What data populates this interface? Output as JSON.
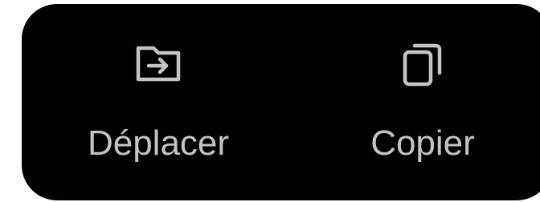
{
  "actions": [
    {
      "label": "Déplacer",
      "icon": "folder-move-icon"
    },
    {
      "label": "Copier",
      "icon": "copy-icon"
    }
  ],
  "colors": {
    "bar_background": "#000000",
    "foreground": "#c4c4c4"
  }
}
